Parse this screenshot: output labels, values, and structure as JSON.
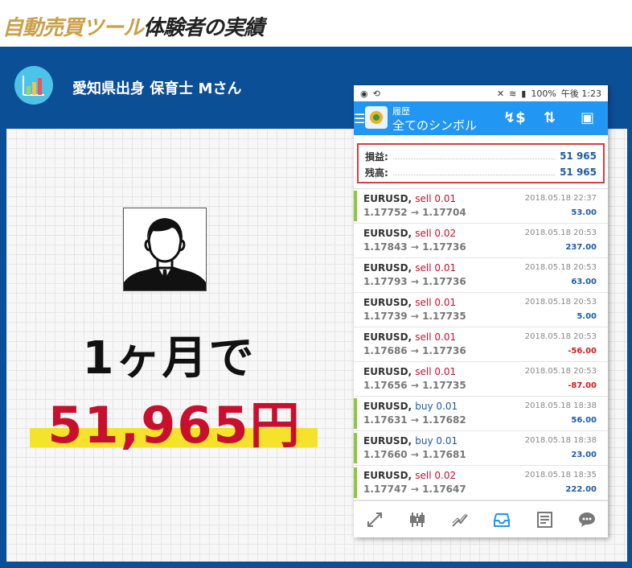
{
  "headline": {
    "part1": "自動売買ツール",
    "part2": "体験者の実績"
  },
  "profile": {
    "name": "愛知県出身 保育士 Mさん"
  },
  "result": {
    "month": "1ヶ月で",
    "amount": "51,965円"
  },
  "colors": {
    "band": "#0b4f97",
    "accent_gold": "#caa04a",
    "amount_red": "#c8102e",
    "highlight": "#f5e22a",
    "app_blue": "#2196f3",
    "profit_blue": "#1e5aa8",
    "loss_red": "#d21a1a",
    "buy_marker": "#8dc63f"
  },
  "phone": {
    "status": {
      "battery": "100%",
      "time": "午後 1:23"
    },
    "appbar": {
      "subtitle": "履歴",
      "title": "全てのシンボル"
    },
    "summary": {
      "profit_label": "損益:",
      "profit_value": "51 965",
      "balance_label": "残高:",
      "balance_value": "51 965"
    },
    "trades": [
      {
        "symbol": "EURUSD,",
        "side": "sell 0.01",
        "prices": "1.17752 → 1.17704",
        "time": "2018.05.18 22:37",
        "profit": "53.00"
      },
      {
        "symbol": "EURUSD,",
        "side": "sell 0.02",
        "prices": "1.17843 → 1.17736",
        "time": "2018.05.18 20:53",
        "profit": "237.00"
      },
      {
        "symbol": "EURUSD,",
        "side": "sell 0.01",
        "prices": "1.17793 → 1.17736",
        "time": "2018.05.18 20:53",
        "profit": "63.00"
      },
      {
        "symbol": "EURUSD,",
        "side": "sell 0.01",
        "prices": "1.17739 → 1.17735",
        "time": "2018.05.18 20:53",
        "profit": "5.00"
      },
      {
        "symbol": "EURUSD,",
        "side": "sell 0.01",
        "prices": "1.17686 → 1.17736",
        "time": "2018.05.18 20:53",
        "profit": "-56.00"
      },
      {
        "symbol": "EURUSD,",
        "side": "sell 0.01",
        "prices": "1.17656 → 1.17735",
        "time": "2018.05.18 20:53",
        "profit": "-87.00"
      },
      {
        "symbol": "EURUSD,",
        "side": "buy 0.01",
        "prices": "1.17631 → 1.17682",
        "time": "2018.05.18 18:38",
        "profit": "56.00"
      },
      {
        "symbol": "EURUSD,",
        "side": "buy 0.01",
        "prices": "1.17660 → 1.17681",
        "time": "2018.05.18 18:38",
        "profit": "23.00"
      },
      {
        "symbol": "EURUSD,",
        "side": "sell 0.02",
        "prices": "1.17747 → 1.17647",
        "time": "2018.05.18 18:35",
        "profit": "222.00"
      }
    ],
    "nav_icons": [
      "quotes-icon",
      "chart-icon",
      "trade-icon",
      "history-icon",
      "news-icon",
      "chat-icon"
    ]
  }
}
